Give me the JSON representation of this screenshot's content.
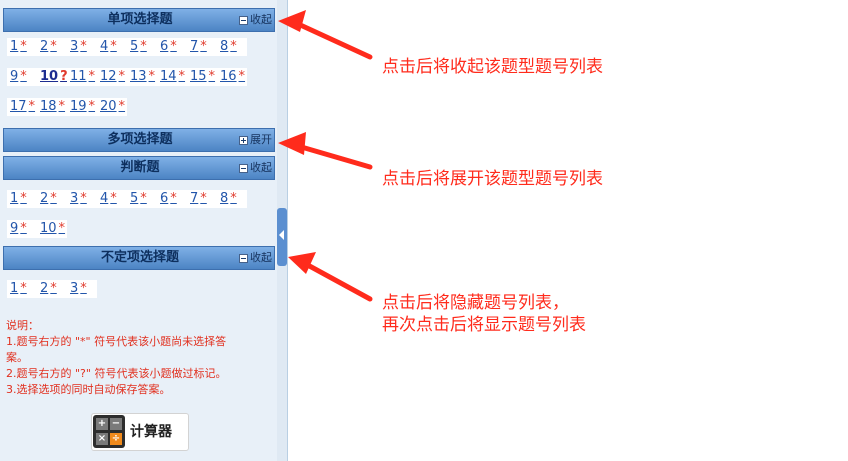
{
  "sections": [
    {
      "title": "单项选择题",
      "toggle": "收起",
      "rows": [
        [
          {
            "n": "1",
            "m": "*"
          },
          {
            "n": "2",
            "m": "*"
          },
          {
            "n": "3",
            "m": "*"
          },
          {
            "n": "4",
            "m": "*"
          },
          {
            "n": "5",
            "m": "*"
          },
          {
            "n": "6",
            "m": "*"
          },
          {
            "n": "7",
            "m": "*"
          },
          {
            "n": "8",
            "m": "*"
          }
        ],
        [
          {
            "n": "9",
            "m": "*"
          },
          {
            "n": "10",
            "m": "?"
          },
          {
            "n": "11",
            "m": "*"
          },
          {
            "n": "12",
            "m": "*"
          },
          {
            "n": "13",
            "m": "*"
          },
          {
            "n": "14",
            "m": "*"
          },
          {
            "n": "15",
            "m": "*"
          },
          {
            "n": "16",
            "m": "*"
          }
        ],
        [
          {
            "n": "17",
            "m": "*"
          },
          {
            "n": "18",
            "m": "*"
          },
          {
            "n": "19",
            "m": "*"
          },
          {
            "n": "20",
            "m": "*"
          }
        ]
      ]
    },
    {
      "title": "多项选择题",
      "toggle": "展开",
      "rows": []
    },
    {
      "title": "判断题",
      "toggle": "收起",
      "rows": [
        [
          {
            "n": "1",
            "m": "*"
          },
          {
            "n": "2",
            "m": "*"
          },
          {
            "n": "3",
            "m": "*"
          },
          {
            "n": "4",
            "m": "*"
          },
          {
            "n": "5",
            "m": "*"
          },
          {
            "n": "6",
            "m": "*"
          },
          {
            "n": "7",
            "m": "*"
          },
          {
            "n": "8",
            "m": "*"
          }
        ],
        [
          {
            "n": "9",
            "m": "*"
          },
          {
            "n": "10",
            "m": "*"
          }
        ]
      ]
    },
    {
      "title": "不定项选择题",
      "toggle": "收起",
      "rows": [
        [
          {
            "n": "1",
            "m": "*"
          },
          {
            "n": "2",
            "m": "*"
          },
          {
            "n": "3",
            "m": "*"
          }
        ]
      ]
    }
  ],
  "note": {
    "heading": "说明：",
    "lines": [
      "1.题号右方的 \"*\" 符号代表该小题尚未选择答",
      "案。",
      "2.题号右方的 \"?\" 符号代表该小题做过标记。",
      "3.选择选项的同时自动保存答案。"
    ]
  },
  "calculator": {
    "label": "计算器",
    "keys": [
      "+",
      "−",
      "×",
      "÷"
    ]
  },
  "callouts": [
    {
      "lines": [
        "点击后将收起该题型题号列表"
      ]
    },
    {
      "lines": [
        "点击后将展开该题型题号列表"
      ]
    },
    {
      "lines": [
        "点击后将隐藏题号列表，",
        "再次点击后将显示题号列表"
      ]
    }
  ],
  "colors": {
    "arrow": "#ff2b1c",
    "header": "#4c84c4",
    "unanswered_mark": "#e03a2c",
    "note_text": "#e1301f"
  }
}
